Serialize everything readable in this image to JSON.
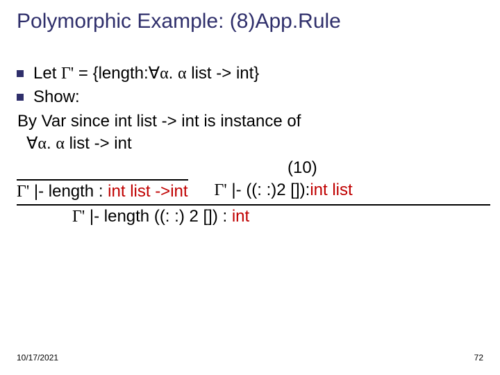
{
  "title": "Polymorphic Example: (8)App.Rule",
  "line1_a": "Let ",
  "gammaP": "Γ'",
  "line1_b": " = {length:",
  "forall": "∀",
  "alpha": "α",
  "line1_c": ". ",
  "line1_d": " list -> int}",
  "line2": "Show:",
  "line3": "By Var since int list -> int  is instance of",
  "line4_a": ". ",
  "line4_b": " list -> int",
  "ten": "(10)",
  "prem_left_a": " |- length : ",
  "kw_intlist_arrow_int": "int list ->int",
  "prem_right_a": " |- ((: :)2 []):",
  "kw_intlist": "int list",
  "concl_a": " |- length ((: :) 2 []) : ",
  "kw_int": "int",
  "date": "10/17/2021",
  "page": "72"
}
